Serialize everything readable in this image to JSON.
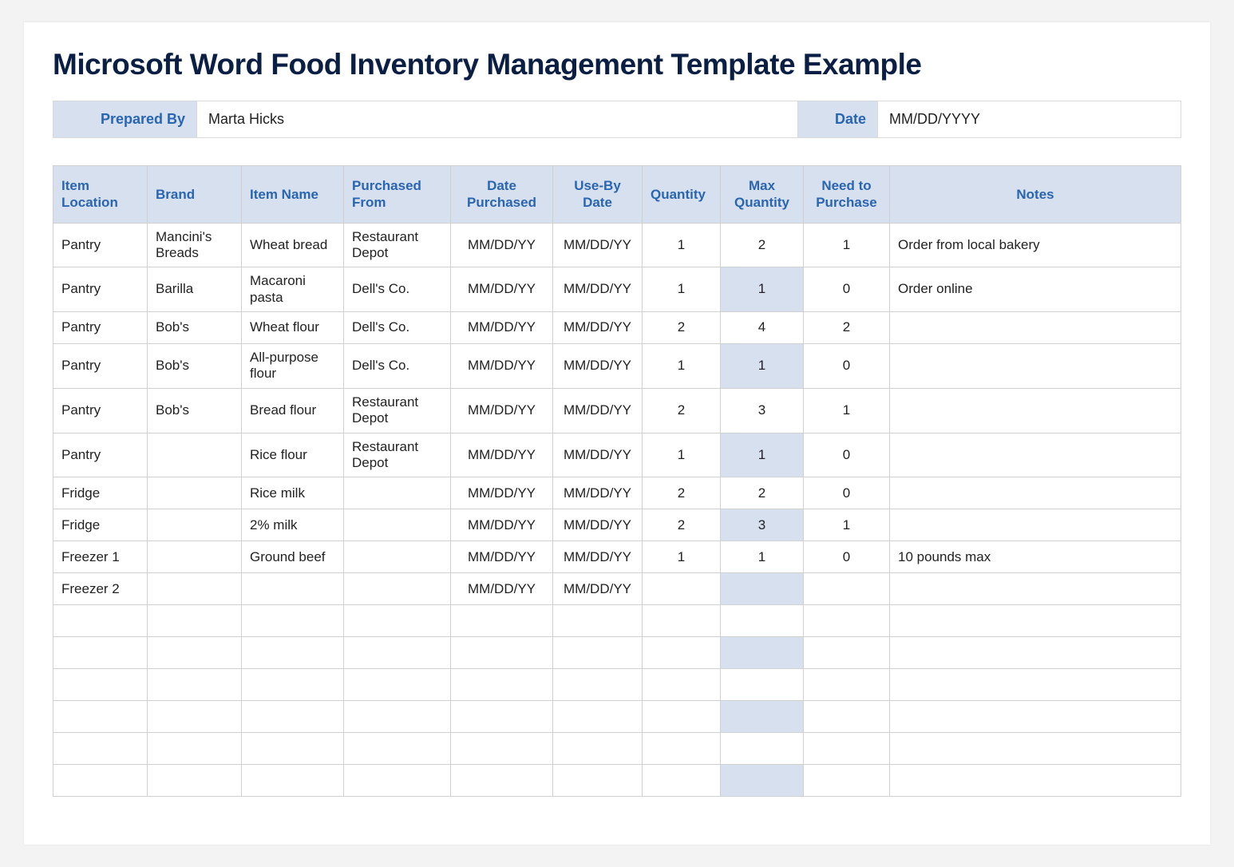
{
  "title": "Microsoft Word Food Inventory Management Template Example",
  "meta": {
    "prepared_by_label": "Prepared By",
    "prepared_by": "Marta Hicks",
    "date_label": "Date",
    "date": "MM/DD/YYYY"
  },
  "headers": {
    "location": "Item Location",
    "brand": "Brand",
    "item": "Item Name",
    "vendor": "Purchased From",
    "date_purchased": "Date Purchased",
    "use_by": "Use-By Date",
    "qty": "Quantity",
    "max": "Max Quantity",
    "need": "Need to Purchase",
    "notes": "Notes"
  },
  "rows": [
    {
      "location": "Pantry",
      "brand": "Mancini's Breads",
      "item": "Wheat bread",
      "vendor": "Restaurant Depot",
      "date_purchased": "MM/DD/YY",
      "use_by": "MM/DD/YY",
      "qty": "1",
      "max": "2",
      "need": "1",
      "notes": "Order from local bakery",
      "max_hl": false
    },
    {
      "location": "Pantry",
      "brand": "Barilla",
      "item": "Macaroni pasta",
      "vendor": "Dell's Co.",
      "date_purchased": "MM/DD/YY",
      "use_by": "MM/DD/YY",
      "qty": "1",
      "max": "1",
      "need": "0",
      "notes": "Order online",
      "max_hl": true
    },
    {
      "location": "Pantry",
      "brand": "Bob's",
      "item": "Wheat flour",
      "vendor": "Dell's Co.",
      "date_purchased": "MM/DD/YY",
      "use_by": "MM/DD/YY",
      "qty": "2",
      "max": "4",
      "need": "2",
      "notes": "",
      "max_hl": false
    },
    {
      "location": "Pantry",
      "brand": "Bob's",
      "item": "All-purpose flour",
      "vendor": "Dell's Co.",
      "date_purchased": "MM/DD/YY",
      "use_by": "MM/DD/YY",
      "qty": "1",
      "max": "1",
      "need": "0",
      "notes": "",
      "max_hl": true
    },
    {
      "location": "Pantry",
      "brand": "Bob's",
      "item": "Bread flour",
      "vendor": "Restaurant Depot",
      "date_purchased": "MM/DD/YY",
      "use_by": "MM/DD/YY",
      "qty": "2",
      "max": "3",
      "need": "1",
      "notes": "",
      "max_hl": false
    },
    {
      "location": "Pantry",
      "brand": "",
      "item": "Rice flour",
      "vendor": "Restaurant Depot",
      "date_purchased": "MM/DD/YY",
      "use_by": "MM/DD/YY",
      "qty": "1",
      "max": "1",
      "need": "0",
      "notes": "",
      "max_hl": true
    },
    {
      "location": "Fridge",
      "brand": "",
      "item": "Rice milk",
      "vendor": "",
      "date_purchased": "MM/DD/YY",
      "use_by": "MM/DD/YY",
      "qty": "2",
      "max": "2",
      "need": "0",
      "notes": "",
      "max_hl": false
    },
    {
      "location": "Fridge",
      "brand": "",
      "item": "2% milk",
      "vendor": "",
      "date_purchased": "MM/DD/YY",
      "use_by": "MM/DD/YY",
      "qty": "2",
      "max": "3",
      "need": "1",
      "notes": "",
      "max_hl": true
    },
    {
      "location": "Freezer 1",
      "brand": "",
      "item": "Ground beef",
      "vendor": "",
      "date_purchased": "MM/DD/YY",
      "use_by": "MM/DD/YY",
      "qty": "1",
      "max": "1",
      "need": "0",
      "notes": "10 pounds max",
      "max_hl": false
    },
    {
      "location": "Freezer 2",
      "brand": "",
      "item": "",
      "vendor": "",
      "date_purchased": "MM/DD/YY",
      "use_by": "MM/DD/YY",
      "qty": "",
      "max": "",
      "need": "",
      "notes": "",
      "max_hl": true
    },
    {
      "location": "",
      "brand": "",
      "item": "",
      "vendor": "",
      "date_purchased": "",
      "use_by": "",
      "qty": "",
      "max": "",
      "need": "",
      "notes": "",
      "max_hl": false
    },
    {
      "location": "",
      "brand": "",
      "item": "",
      "vendor": "",
      "date_purchased": "",
      "use_by": "",
      "qty": "",
      "max": "",
      "need": "",
      "notes": "",
      "max_hl": true
    },
    {
      "location": "",
      "brand": "",
      "item": "",
      "vendor": "",
      "date_purchased": "",
      "use_by": "",
      "qty": "",
      "max": "",
      "need": "",
      "notes": "",
      "max_hl": false
    },
    {
      "location": "",
      "brand": "",
      "item": "",
      "vendor": "",
      "date_purchased": "",
      "use_by": "",
      "qty": "",
      "max": "",
      "need": "",
      "notes": "",
      "max_hl": true
    },
    {
      "location": "",
      "brand": "",
      "item": "",
      "vendor": "",
      "date_purchased": "",
      "use_by": "",
      "qty": "",
      "max": "",
      "need": "",
      "notes": "",
      "max_hl": false
    },
    {
      "location": "",
      "brand": "",
      "item": "",
      "vendor": "",
      "date_purchased": "",
      "use_by": "",
      "qty": "",
      "max": "",
      "need": "",
      "notes": "",
      "max_hl": true
    }
  ]
}
